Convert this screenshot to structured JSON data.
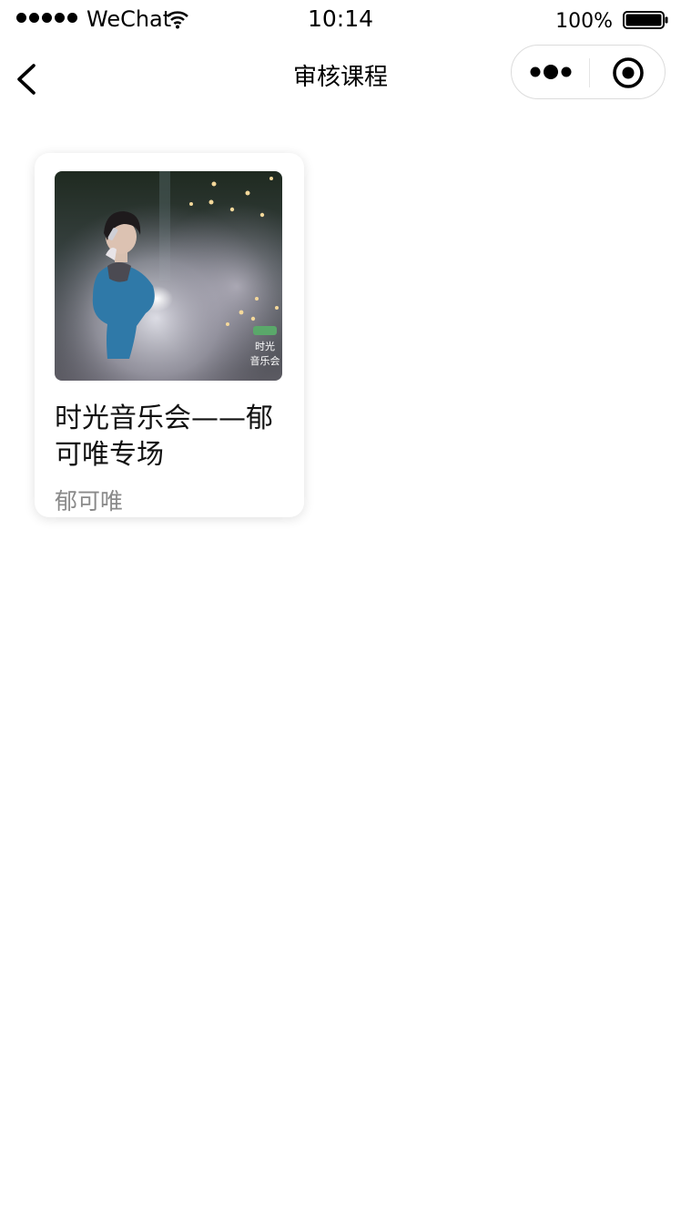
{
  "status_bar": {
    "carrier": "WeChat",
    "time": "10:14",
    "battery": "100%"
  },
  "nav": {
    "title": "审核课程"
  },
  "courses": [
    {
      "title": "时光音乐会——郁可唯专场",
      "author": "郁可唯",
      "cover_logo": "时光音乐会"
    }
  ],
  "colors": {
    "author_text": "#8a8a8a",
    "capsule_border": "#dcdcdc"
  },
  "icons": [
    "signal-icon",
    "wifi-icon",
    "battery-icon",
    "back-icon",
    "more-icon",
    "close-icon"
  ]
}
